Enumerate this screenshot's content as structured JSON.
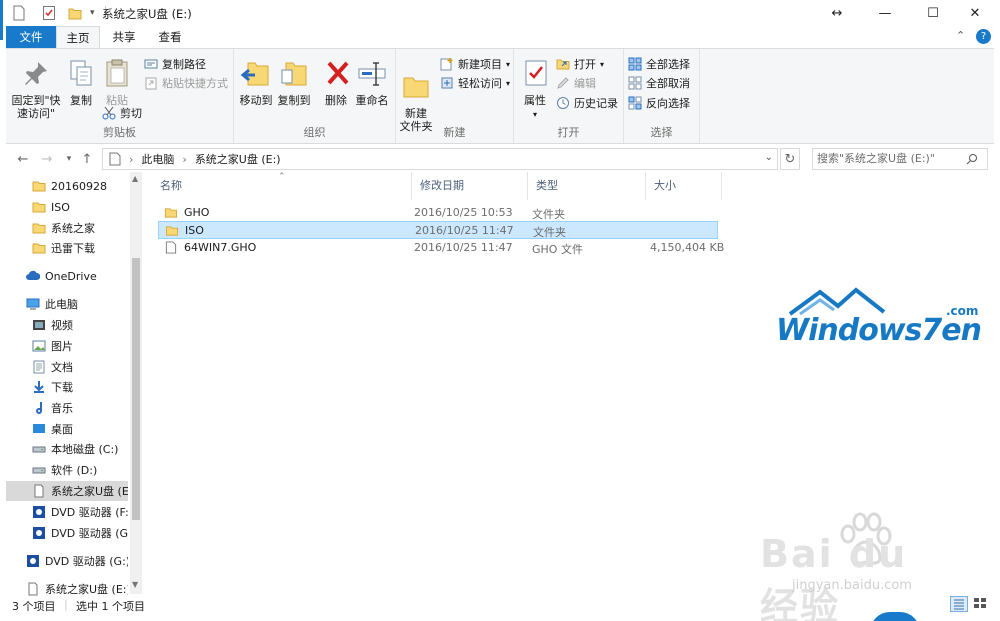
{
  "window": {
    "title": "系统之家U盘 (E:)",
    "resize_glyph": "↔",
    "minimize_glyph": "—",
    "maximize_glyph": "☐",
    "close_glyph": "✕"
  },
  "ribbon_tabs": [
    "文件",
    "主页",
    "共享",
    "查看"
  ],
  "ribbon_expand_glyph": "⌃",
  "help_glyph": "?",
  "clipboard": {
    "pin": "固定到\"快速访问\"",
    "copy": "复制",
    "paste": "粘贴",
    "copy_path": "复制路径",
    "paste_shortcut": "粘贴快捷方式",
    "cut": "剪切",
    "label": "剪贴板"
  },
  "organize": {
    "move_to": "移动到",
    "copy_to": "复制到",
    "delete": "删除",
    "rename": "重命名",
    "label": "组织"
  },
  "new_group": {
    "new_folder": "新建\n文件夹",
    "new_item": "新建项目",
    "easy_access": "轻松访问",
    "label": "新建"
  },
  "open_group": {
    "properties": "属性",
    "open": "打开",
    "edit": "编辑",
    "history": "历史记录",
    "label": "打开"
  },
  "select_group": {
    "select_all": "全部选择",
    "select_none": "全部取消",
    "invert": "反向选择",
    "label": "选择"
  },
  "address": {
    "crumbs": [
      "此电脑",
      "系统之家U盘 (E:)"
    ],
    "search_placeholder": "搜索\"系统之家U盘 (E:)\""
  },
  "navpane": [
    {
      "label": "20160928",
      "icon": "folder-icon"
    },
    {
      "label": "ISO",
      "icon": "folder-icon"
    },
    {
      "label": "系统之家",
      "icon": "folder-icon"
    },
    {
      "label": "迅雷下载",
      "icon": "folder-icon"
    },
    {
      "label": "OneDrive",
      "icon": "cloud-icon"
    },
    {
      "label": "此电脑",
      "icon": "computer-icon"
    },
    {
      "label": "视频",
      "icon": "video-icon"
    },
    {
      "label": "图片",
      "icon": "picture-icon"
    },
    {
      "label": "文档",
      "icon": "document-icon"
    },
    {
      "label": "下载",
      "icon": "download-icon"
    },
    {
      "label": "音乐",
      "icon": "music-icon"
    },
    {
      "label": "桌面",
      "icon": "desktop-icon"
    },
    {
      "label": "本地磁盘 (C:)",
      "icon": "drive-icon"
    },
    {
      "label": "软件 (D:)",
      "icon": "drive-icon"
    },
    {
      "label": "系统之家U盘 (E:)",
      "icon": "usb-drive-icon"
    },
    {
      "label": "DVD 驱动器 (F:)",
      "icon": "dvd-icon"
    },
    {
      "label": "DVD 驱动器 (G:)",
      "icon": "dvd-icon"
    },
    {
      "label": "DVD 驱动器 (G:)",
      "icon": "dvd-icon"
    },
    {
      "label": "系统之家U盘 (E:)",
      "icon": "usb-drive-icon"
    }
  ],
  "columns": [
    "名称",
    "修改日期",
    "类型",
    "大小"
  ],
  "files": [
    {
      "name": "GHO",
      "date": "2016/10/25 10:53",
      "type": "文件夹",
      "size": "",
      "icon": "folder-icon"
    },
    {
      "name": "ISO",
      "date": "2016/10/25 11:47",
      "type": "文件夹",
      "size": "",
      "icon": "folder-icon"
    },
    {
      "name": "64WIN7.GHO",
      "date": "2016/10/25 11:47",
      "type": "GHO 文件",
      "size": "4,150,404 KB",
      "icon": "file-icon"
    }
  ],
  "status": {
    "count": "3 个项目",
    "selected": "选中 1 个项目"
  },
  "watermark": {
    "logo": "Windows7en",
    "logo_suffix": ".com",
    "baidu": "Bai du 经验",
    "baidu_url": "jingyan.baidu.com"
  },
  "colors": {
    "accent": "#1979ca",
    "selection": "#cce8ff",
    "folder": "#f8d775"
  }
}
